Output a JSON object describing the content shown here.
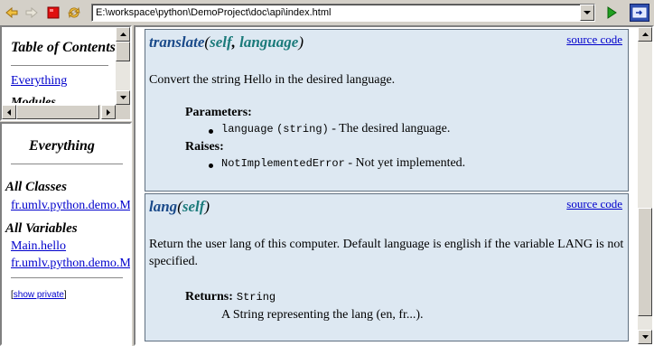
{
  "toolbar": {
    "url": "E:\\workspace\\python\\DemoProject\\doc\\api\\index.html"
  },
  "icons": {
    "back": "back-arrow-icon",
    "forward": "forward-arrow-icon",
    "stop": "stop-icon",
    "refresh": "refresh-icon",
    "go": "go-icon",
    "external": "external-browser-icon"
  },
  "toc": {
    "title": "Table of Contents",
    "link_everything": "Everything",
    "cut_text": "Modules"
  },
  "index": {
    "title": "Everything",
    "all_classes": "All Classes",
    "class_link": "fr.umlv.python.demo.Main",
    "all_variables": "All Variables",
    "var_link_1": "Main.hello",
    "var_link_2": "fr.umlv.python.demo.Main.lang",
    "show_private_open": "[",
    "show_private": "show private",
    "show_private_close": "]"
  },
  "doc": {
    "translate": {
      "name": "translate",
      "open": "(",
      "arg1": "self",
      "comma": ", ",
      "arg2": "language",
      "close": ")",
      "source": "source code",
      "description": "Convert the string Hello in the desired language.",
      "parameters_label": "Parameters:",
      "param_name": "language",
      "param_type": "(string)",
      "param_desc": " - The desired language.",
      "raises_label": "Raises:",
      "raise_name": "NotImplementedError",
      "raise_desc": " - Not yet implemented."
    },
    "lang": {
      "name": "lang",
      "open": "(",
      "arg1": "self",
      "close": ")",
      "source": "source code",
      "description": "Return the user lang of this computer. Default language is english if the variable LANG is not specified.",
      "returns_label": "Returns:",
      "return_type": "String",
      "return_desc": "A String representing the lang (en, fr...)."
    }
  },
  "colors": {
    "chrome": "#d4d0c8",
    "doc_bg": "#dde8f2",
    "fn_name": "#1a4a8a",
    "fn_arg": "#1a7a7a",
    "link": "#0000cc"
  }
}
